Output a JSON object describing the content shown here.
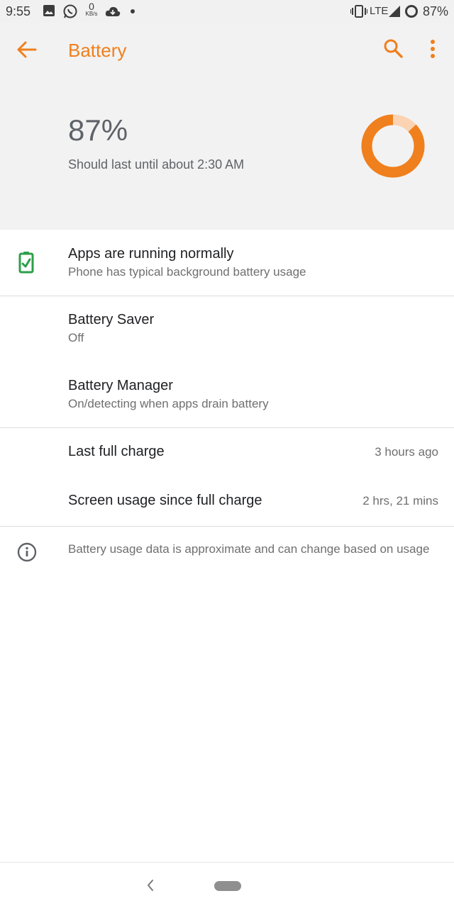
{
  "status_bar": {
    "time": "9:55",
    "kbs_value": "0",
    "kbs_unit": "KB/s",
    "network": "LTE",
    "battery_percent": "87%",
    "icons": [
      "image-icon",
      "whatsapp-icon",
      "cloud-download-icon",
      "dot-icon",
      "vibrate-icon",
      "signal-icon",
      "battery-saver-ring-icon"
    ]
  },
  "header": {
    "title": "Battery",
    "percent": "87%",
    "estimate": "Should last until about 2:30 AM",
    "battery_level": 0.87,
    "accent_color": "#f07f1d",
    "ring_track_color": "#fbd3b3"
  },
  "items": {
    "apps": {
      "title": "Apps are running normally",
      "subtitle": "Phone has typical background battery usage",
      "icon": "battery-check-icon",
      "icon_color": "#2e9e4a"
    },
    "saver": {
      "title": "Battery Saver",
      "subtitle": "Off"
    },
    "manager": {
      "title": "Battery Manager",
      "subtitle": "On/detecting when apps drain battery"
    },
    "last_charge": {
      "title": "Last full charge",
      "value": "3 hours ago"
    },
    "screen_usage": {
      "title": "Screen usage since full charge",
      "value": "2 hrs, 21 mins"
    },
    "footer_info": {
      "text": "Battery usage data is approximate and can change based on usage",
      "icon": "info-icon"
    }
  },
  "nav": {
    "icons": [
      "nav-back-icon",
      "nav-home-pill"
    ]
  }
}
